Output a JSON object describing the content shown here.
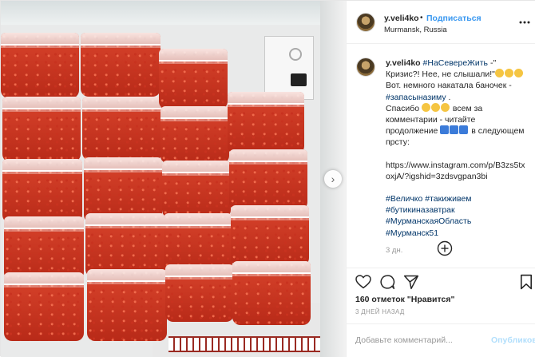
{
  "post": {
    "username": "y.veli4ko",
    "follow_label": "Подписаться",
    "separator": "•",
    "location": "Murmansk, Russia",
    "more_icon": "more-icon",
    "next_arrow": "›",
    "caption": {
      "username": "y.veli4ko",
      "line1_tag": "#НаСевереЖить",
      "line1_rest": " -\" Кризис?! Нее, не слышали!\"",
      "line1_after_emoji": " Вот. немного накатала баночек -",
      "tag_zapasy": "#запасыназиму",
      "tag_zapasy_end": " .",
      "thanks_start": "Спасибо ",
      "thanks_end": " всем за комментарии - читайте продолжение ",
      "thanks_tail": " в следующем прсту:",
      "link": "https://www.instagram.com/p/B3zs5txoxjA/?igshid=3zdsvgpan3bi",
      "tags_line1": [
        "#Величко",
        "#такиживем"
      ],
      "tags_line2": [
        "#бутикиназавтрак"
      ],
      "tags_line3": [
        "#МурманскаяОбласть",
        "#Мурманск51"
      ],
      "time": "3 дн."
    },
    "likes": "160 отметок \"Нравится\"",
    "time_ago": "3 ДНЕЙ НАЗАД",
    "comment_placeholder": "Добавьте комментарий...",
    "publish_label": "Опубликовать",
    "icons": [
      "heart-icon",
      "comment-icon",
      "share-icon",
      "bookmark-icon",
      "add-icon"
    ]
  }
}
